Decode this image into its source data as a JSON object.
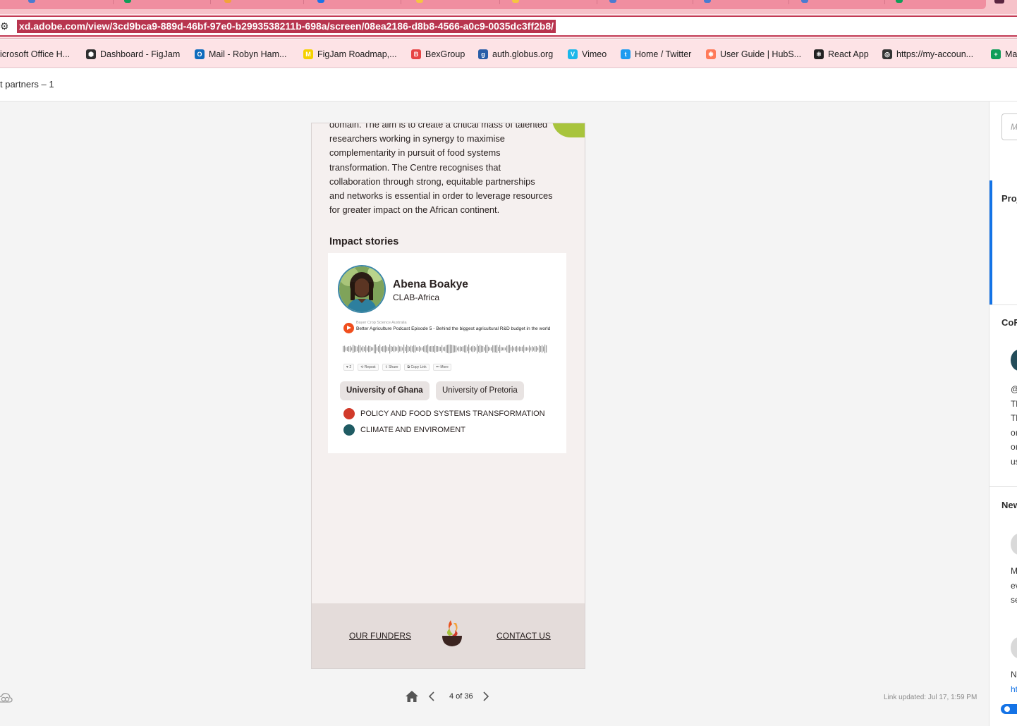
{
  "browser": {
    "url": "xd.adobe.com/view/3cd9bca9-889d-46bf-97e0-b2993538211b-698a/screen/08ea2186-d8b8-4566-a0c9-0035dc3ff2b8/",
    "bookmarks": [
      {
        "label": "icrosoft Office H...",
        "icon": "office-icon",
        "color": "#e8531f"
      },
      {
        "label": "Dashboard - FigJam",
        "icon": "figjam-icon",
        "color": "#2f2f2f"
      },
      {
        "label": "Mail - Robyn Ham...",
        "icon": "outlook-icon",
        "color": "#0f6cbd"
      },
      {
        "label": "FigJam Roadmap,...",
        "icon": "miro-icon",
        "color": "#f5d100"
      },
      {
        "label": "BexGroup",
        "icon": "bex-icon",
        "color": "#e64545"
      },
      {
        "label": "auth.globus.org",
        "icon": "globus-icon",
        "color": "#2a5ea8"
      },
      {
        "label": "Vimeo",
        "icon": "vimeo-icon",
        "color": "#1ab7ea"
      },
      {
        "label": "Home / Twitter",
        "icon": "twitter-icon",
        "color": "#1d9bf0"
      },
      {
        "label": "User Guide | HubS...",
        "icon": "hubspot-icon",
        "color": "#ff7a59"
      },
      {
        "label": "React App",
        "icon": "react-icon",
        "color": "#222222"
      },
      {
        "label": "https://my-accoun...",
        "icon": "globe-icon",
        "color": "#333333"
      },
      {
        "label": "Ma",
        "icon": "sheets-icon",
        "color": "#0f9d58"
      }
    ]
  },
  "xd": {
    "title": "t partners – 1",
    "page_counter": "4 of 36",
    "link_updated": "Link updated: Jul 17, 1:59 PM"
  },
  "artboard": {
    "intro_lines": [
      "domain. The aim is to create a critical mass of talented",
      "researchers working in synergy to maximise",
      "complementarity in pursuit of food systems",
      "transformation. The Centre recognises that",
      "collaboration through strong, equitable partnerships",
      "and networks is essential in order to leverage resources",
      "for greater impact on the African continent."
    ],
    "section_title": "Impact stories",
    "story": {
      "name": "Abena Boakye",
      "org": "CLAB-Africa",
      "podcast": {
        "source": "Bayer Crop Science Australia",
        "title": "Better Agriculture Podcast Episode 5 - Behind the biggest agricultural R&D budget in the world",
        "actions": [
          "♥ 2",
          "⟲ Repost",
          "⇪ Share",
          "⧉ Copy Link",
          "••• More"
        ]
      },
      "chips": [
        "University of Ghana",
        "University of Pretoria"
      ],
      "topics": [
        {
          "label": "POLICY AND FOOD SYSTEMS TRANSFORMATION",
          "color": "#d13a2a"
        },
        {
          "label": "CLIMATE AND ENVIROMENT",
          "color": "#1f5b63"
        }
      ]
    },
    "footer": {
      "funders": "OUR FUNDERS",
      "contact": "CONTACT US"
    }
  },
  "right_panel": {
    "input_placeholder": "M",
    "section1": "Proj",
    "section2": "CoR",
    "section3": "New",
    "comment_lines": [
      "@",
      "Tl",
      "Tl",
      "oı",
      "oı",
      "us"
    ],
    "new_lines_a": [
      "M",
      "ev",
      "se"
    ],
    "new_lines_b": [
      "N",
      "ht"
    ]
  }
}
